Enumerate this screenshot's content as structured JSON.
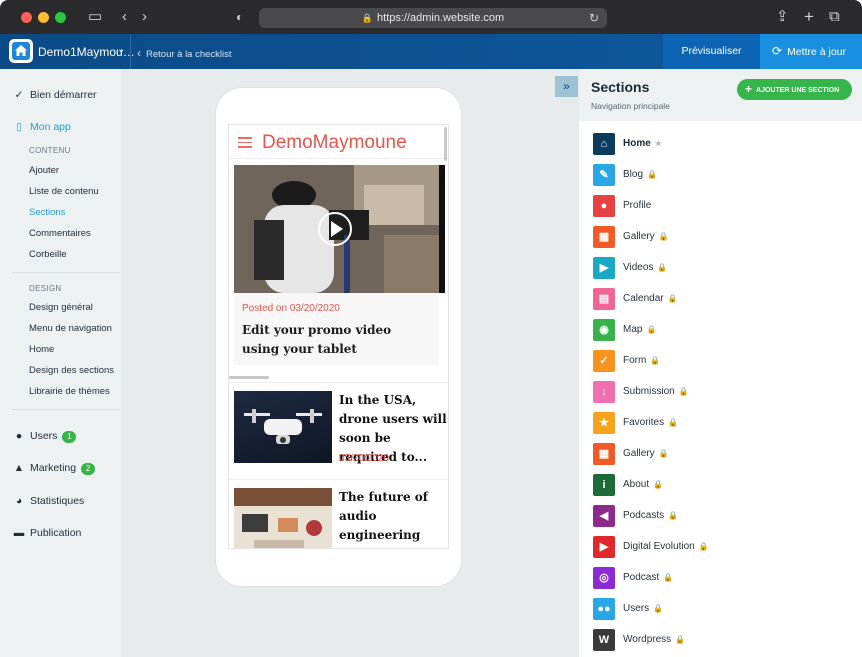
{
  "browser": {
    "url": "https://admin.website.com"
  },
  "appbar": {
    "app_name": "Demo1Maymou…",
    "back_label": "Retour à la checklist",
    "preview_label": "Prévisualiser",
    "update_label": "Mettre à jour"
  },
  "sidebar": {
    "start_label": "Bien démarrer",
    "myapp_label": "Mon app",
    "content_caption": "CONTENU",
    "content_items": [
      "Ajouter",
      "Liste de contenu",
      "Sections",
      "Commentaires",
      "Corbeille"
    ],
    "design_caption": "DESIGN",
    "design_items": [
      "Design général",
      "Menu de navigation",
      "Home",
      "Design des sections",
      "Librairie de thèmes"
    ],
    "users_label": "Users",
    "users_count": "1",
    "marketing_label": "Marketing",
    "marketing_count": "2",
    "stats_label": "Statistiques",
    "publish_label": "Publication"
  },
  "phone": {
    "title": "DemoMaymoune",
    "featured": {
      "date": "Posted on 03/20/2020",
      "title": "Edit your promo video using your tablet"
    },
    "items": [
      {
        "title": "In the USA, drone users will soon be required to...",
        "date": "03/20/2020"
      },
      {
        "title": "The future of audio engineering",
        "date": ""
      }
    ]
  },
  "panel": {
    "title": "Sections",
    "subtitle": "Navigation principale",
    "add_label": "AJOUTER UNE SECTION",
    "sections": [
      {
        "label": "Home",
        "icon": "home-icon",
        "color": "#0d3b5e",
        "glyph": "⌂",
        "mark": "★"
      },
      {
        "label": "Blog",
        "icon": "pencil-icon",
        "color": "#29a6e6",
        "glyph": "✎",
        "mark": "🔒"
      },
      {
        "label": "Profile",
        "icon": "person-icon",
        "color": "#e84141",
        "glyph": "●",
        "mark": ""
      },
      {
        "label": "Gallery",
        "icon": "image-icon",
        "color": "#f15a24",
        "glyph": "▦",
        "mark": "🔒"
      },
      {
        "label": "Videos",
        "icon": "video-icon",
        "color": "#1aa9c4",
        "glyph": "▶",
        "mark": "🔒"
      },
      {
        "label": "Calendar",
        "icon": "calendar-icon",
        "color": "#f06595",
        "glyph": "▤",
        "mark": "🔒"
      },
      {
        "label": "Map",
        "icon": "map-pin-icon",
        "color": "#37b34a",
        "glyph": "◉",
        "mark": "🔒"
      },
      {
        "label": "Form",
        "icon": "checkbox-icon",
        "color": "#f7931e",
        "glyph": "✓",
        "mark": "🔒"
      },
      {
        "label": "Submission",
        "icon": "download-icon",
        "color": "#f06fb0",
        "glyph": "↓",
        "mark": "🔒"
      },
      {
        "label": "Favorites",
        "icon": "star-icon",
        "color": "#f7a21b",
        "glyph": "★",
        "mark": "🔒"
      },
      {
        "label": "Gallery",
        "icon": "image-icon",
        "color": "#f15a24",
        "glyph": "▦",
        "mark": "🔒"
      },
      {
        "label": "About",
        "icon": "info-icon",
        "color": "#1e6b3a",
        "glyph": "i",
        "mark": "🔒"
      },
      {
        "label": "Podcasts",
        "icon": "speaker-icon",
        "color": "#8e2a8e",
        "glyph": "◀",
        "mark": "🔒"
      },
      {
        "label": "Digital Evolution",
        "icon": "youtube-icon",
        "color": "#e02828",
        "glyph": "▶",
        "mark": "🔒"
      },
      {
        "label": "Podcast",
        "icon": "podcast-icon",
        "color": "#8a2bd6",
        "glyph": "◎",
        "mark": "🔒"
      },
      {
        "label": "Users",
        "icon": "users-icon",
        "color": "#29a6e6",
        "glyph": "●●",
        "mark": "🔒"
      },
      {
        "label": "Wordpress",
        "icon": "wordpress-icon",
        "color": "#3a3a3a",
        "glyph": "W",
        "mark": "🔒"
      }
    ]
  }
}
